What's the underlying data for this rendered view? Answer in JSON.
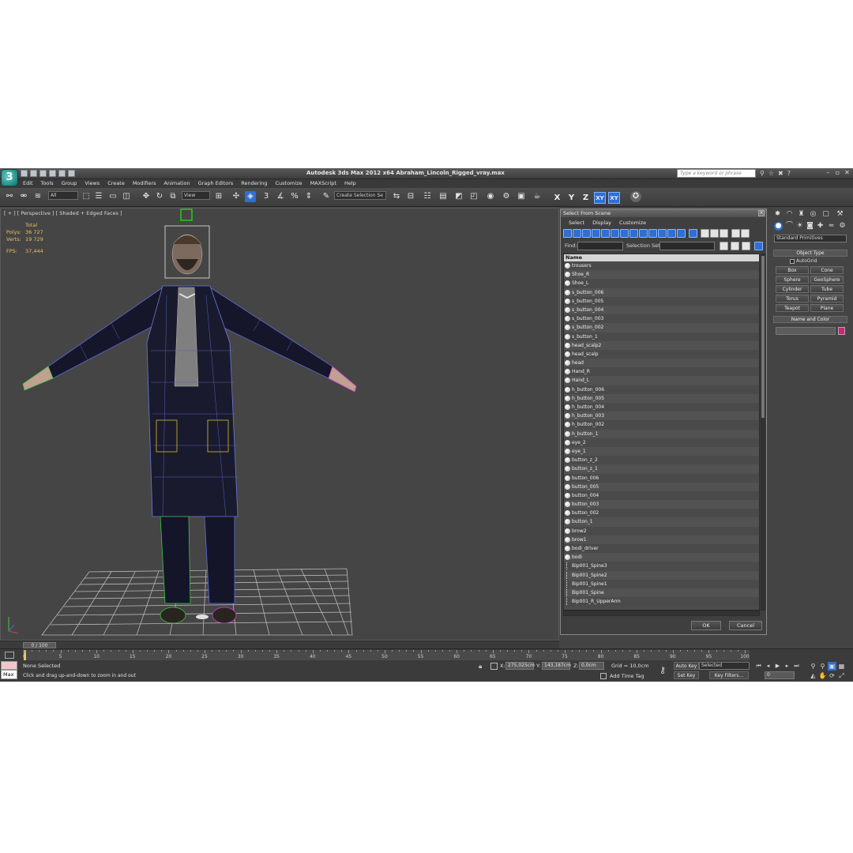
{
  "app": {
    "title": "Autodesk 3ds Max  2012 x64      Abraham_Lincoln_Rigged_vray.max",
    "logo_glyph": "3",
    "search_placeholder": "Type a keyword or phrase",
    "icons": [
      "binoculars-icon",
      "star-icon",
      "favorites-icon",
      "help-icon"
    ]
  },
  "menubar": [
    "Edit",
    "Tools",
    "Group",
    "Views",
    "Create",
    "Modifiers",
    "Animation",
    "Graph Editors",
    "Rendering",
    "Customize",
    "MAXScript",
    "Help"
  ],
  "toolbar": {
    "selection_filter": "All",
    "ref_coord": "View",
    "snap_angle": "3",
    "named_selection": "Create Selection Se",
    "axis_buttons": [
      {
        "label": "X",
        "active": false
      },
      {
        "label": "Y",
        "active": false
      },
      {
        "label": "Z",
        "active": false
      },
      {
        "label": "XY",
        "active": true
      },
      {
        "label": "XY",
        "active": true
      }
    ]
  },
  "viewport": {
    "label": "[ + ] [ Perspective ] [ Shaded + Edged Faces ]",
    "stats": {
      "total_label": "Total",
      "polys_label": "Polys:",
      "polys": "36 727",
      "verts_label": "Verts:",
      "verts": "19 729",
      "fps_label": "FPS:",
      "fps": "37,444"
    },
    "frame_counter": "0 / 100"
  },
  "dialog": {
    "title": "Select From Scene",
    "menu": [
      "Select",
      "Display",
      "Customize"
    ],
    "find_label": "Find:",
    "selset_label": "Selection Set:",
    "column_header": "Name",
    "items": [
      {
        "name": "trousers",
        "kind": "mesh"
      },
      {
        "name": "Shoe_R",
        "kind": "mesh"
      },
      {
        "name": "Shoe_L",
        "kind": "mesh"
      },
      {
        "name": "s_button_006",
        "kind": "mesh"
      },
      {
        "name": "s_button_005",
        "kind": "mesh"
      },
      {
        "name": "s_button_004",
        "kind": "mesh"
      },
      {
        "name": "s_button_003",
        "kind": "mesh"
      },
      {
        "name": "s_button_002",
        "kind": "mesh"
      },
      {
        "name": "s_button_1",
        "kind": "mesh"
      },
      {
        "name": "head_scalp2",
        "kind": "mesh"
      },
      {
        "name": "head_scalp",
        "kind": "mesh"
      },
      {
        "name": "head",
        "kind": "mesh"
      },
      {
        "name": "Hand_R",
        "kind": "mesh"
      },
      {
        "name": "Hand_L",
        "kind": "mesh"
      },
      {
        "name": "h_button_006",
        "kind": "mesh"
      },
      {
        "name": "h_button_005",
        "kind": "mesh"
      },
      {
        "name": "h_button_004",
        "kind": "mesh"
      },
      {
        "name": "h_button_003",
        "kind": "mesh"
      },
      {
        "name": "h_button_002",
        "kind": "mesh"
      },
      {
        "name": "h_button_1",
        "kind": "mesh"
      },
      {
        "name": "eye_2",
        "kind": "mesh"
      },
      {
        "name": "eye_1",
        "kind": "mesh"
      },
      {
        "name": "button_z_2",
        "kind": "mesh"
      },
      {
        "name": "button_z_1",
        "kind": "mesh"
      },
      {
        "name": "button_006",
        "kind": "mesh"
      },
      {
        "name": "button_005",
        "kind": "mesh"
      },
      {
        "name": "button_004",
        "kind": "mesh"
      },
      {
        "name": "button_003",
        "kind": "mesh"
      },
      {
        "name": "button_002",
        "kind": "mesh"
      },
      {
        "name": "button_1",
        "kind": "mesh"
      },
      {
        "name": "brow2",
        "kind": "mesh"
      },
      {
        "name": "brow1",
        "kind": "mesh"
      },
      {
        "name": "bodi_driver",
        "kind": "mesh"
      },
      {
        "name": "bodi",
        "kind": "mesh"
      },
      {
        "name": "Bip001_Spine3",
        "kind": "bone"
      },
      {
        "name": "Bip001_Spine2",
        "kind": "bone"
      },
      {
        "name": "Bip001_Spine1",
        "kind": "bone"
      },
      {
        "name": "Bip001_Spine",
        "kind": "bone"
      },
      {
        "name": "Bip001_R_UpperArm",
        "kind": "bone"
      }
    ],
    "ok": "OK",
    "cancel": "Cancel"
  },
  "command_panel": {
    "primitive_type": "Standard Primitives",
    "object_type_title": "Object Type",
    "autogrid": "AutoGrid",
    "buttons": [
      "Box",
      "Cone",
      "Sphere",
      "GeoSphere",
      "Cylinder",
      "Tube",
      "Torus",
      "Pyramid",
      "Teapot",
      "Plane"
    ],
    "name_color_title": "Name and Color",
    "object_color": "#d0217a"
  },
  "timeline": {
    "ticks": [
      "0",
      "5",
      "10",
      "15",
      "20",
      "25",
      "30",
      "35",
      "40",
      "45",
      "50",
      "55",
      "60",
      "65",
      "70",
      "75",
      "80",
      "85",
      "90",
      "95",
      "100"
    ]
  },
  "status": {
    "maxscript_label": "Max",
    "selection": "None Selected",
    "prompt": "Click and drag up-and-down to zoom in and out",
    "x_label": "X:",
    "x": "275,025cm",
    "y_label": "Y:",
    "y": "143,187cm",
    "z_label": "Z:",
    "z": "0,0cm",
    "grid": "Grid = 10,0cm",
    "add_time_tag": "Add Time Tag",
    "auto_key": "Auto Key",
    "set_key": "Set Key",
    "selected_dd": "Selected",
    "key_filters": "Key Filters...",
    "frame": "0"
  }
}
